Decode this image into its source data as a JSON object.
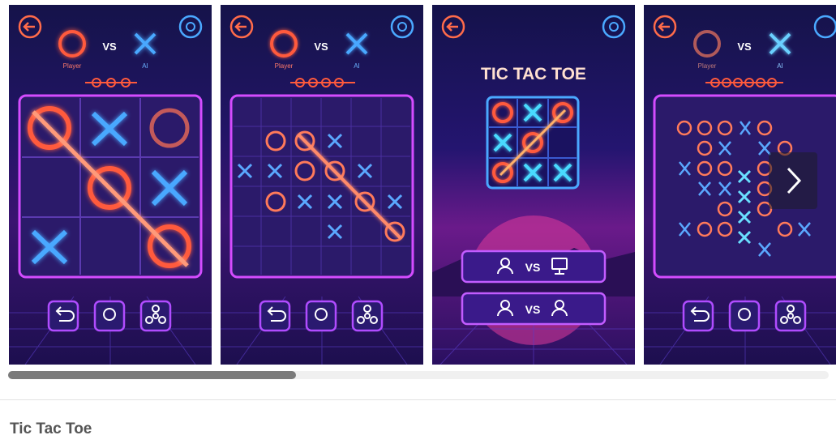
{
  "app_title": "Tic Tac Toe",
  "screens": [
    {
      "player_label": "Player",
      "ai_label": "AI",
      "vs": "VS"
    },
    {
      "player_label": "Player",
      "ai_label": "AI",
      "vs": "VS"
    },
    {
      "title": "TIC TAC TOE",
      "mode1_vs": "VS",
      "mode2_vs": "VS"
    },
    {
      "player_label": "Player",
      "ai_label": "AI",
      "vs": "VS"
    }
  ],
  "icons": [
    "back-icon",
    "settings-icon",
    "undo-icon",
    "hint-icon",
    "fan-icon",
    "player-icon",
    "computer-icon",
    "chevron-right-icon"
  ],
  "colors": {
    "o_neon": "#ff5a3c",
    "x_neon": "#4aa8ff",
    "board_border": "#d44cff",
    "bg_dark": "#1a1650"
  }
}
